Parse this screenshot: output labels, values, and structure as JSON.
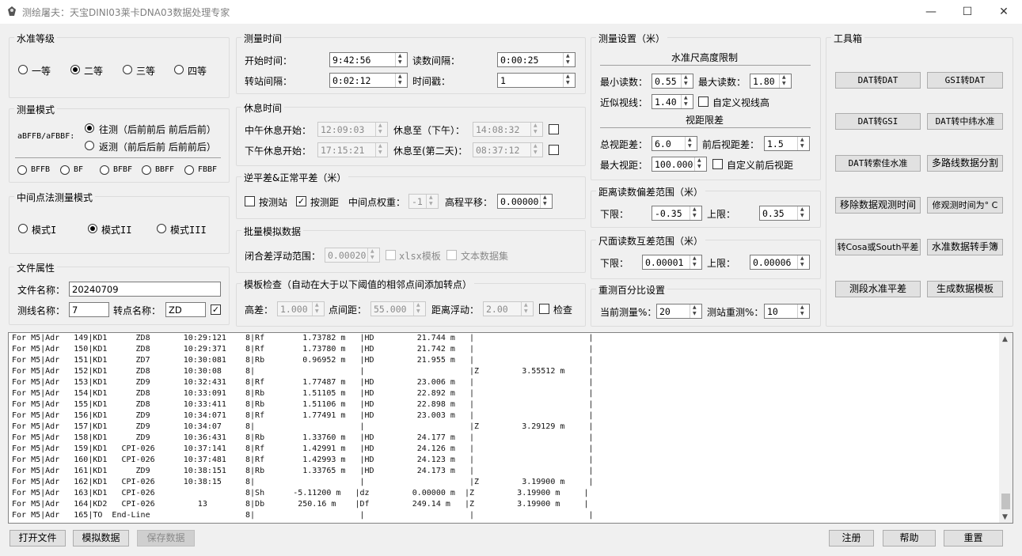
{
  "window": {
    "title": "测绘屠夫：天宝DINI03莱卡DNA03数据处理专家",
    "minimize": "—",
    "maximize": "☐",
    "close": "✕"
  },
  "level_grade": {
    "title": "水准等级",
    "options": [
      "一等",
      "二等",
      "三等",
      "四等"
    ],
    "selected": 1
  },
  "measure_mode": {
    "title": "测量模式",
    "prefix": "aBFFB/aFBBF:",
    "options": [
      "往测（后前前后 前后后前）",
      "返测（前后后前 后前前后）"
    ],
    "selected": 0,
    "patterns": [
      "BFFB",
      "BF",
      "BFBF",
      "BBFF",
      "FBBF"
    ]
  },
  "midpoint_mode": {
    "title": "中间点法测量模式",
    "options": [
      "模式I",
      "模式II",
      "模式III"
    ],
    "selected": 1
  },
  "file_props": {
    "title": "文件属性",
    "filename_label": "文件名称：",
    "filename": "20240709",
    "line_label": "测线名称：",
    "line_value": "7",
    "turn_label": "转点名称：",
    "turn_value": "ZD",
    "turn_checked": true
  },
  "measure_time": {
    "title": "测量时间",
    "start_label": "开始时间：",
    "start": "9:42:56",
    "interval_label": "读数间隔：",
    "interval": "0:00:25",
    "station_label": "转站间隔：",
    "station": "0:02:12",
    "stamp_label": "时间戳：",
    "stamp": "1"
  },
  "rest_time": {
    "title": "休息时间",
    "noon_start_label": "中午休息开始：",
    "noon_start": "12:09:03",
    "noon_end_label": "休息至（下午）：",
    "noon_end": "14:08:32",
    "pm_start_label": "下午休息开始：",
    "pm_start": "17:15:21",
    "pm_end_label": "休息至(第二天)：",
    "pm_end": "08:37:12"
  },
  "adjust": {
    "title": "逆平差&正常平差（米）",
    "by_station": "按测站",
    "by_station_checked": false,
    "by_distance": "按测距",
    "by_distance_checked": true,
    "weight_label": "中间点权重：",
    "weight": "-1",
    "shift_label": "高程平移：",
    "shift": "0.00000"
  },
  "batch": {
    "title": "批量模拟数据",
    "closure_label": "闭合差浮动范围：",
    "closure": "0.00020",
    "xlsx_label": "xlsx模板",
    "text_label": "文本数据集"
  },
  "template_check": {
    "title": "模板检查（自动在大于以下阈值的相邻点间添加转点）",
    "height_label": "高差：",
    "height": "1.000",
    "dist_label": "点间距：",
    "dist": "55.000",
    "float_label": "距离浮动：",
    "float": "2.00",
    "check_label": "检查"
  },
  "measure_settings": {
    "title": "测量设置（米）",
    "staff_title": "水准尺高度限制",
    "min_label": "最小读数：",
    "min": "0.55",
    "max_label": "最大读数：",
    "max": "1.80",
    "near_label": "近似视线：",
    "near": "1.40",
    "custom_sight_label": "自定义视线高",
    "sight_title": "视距限差",
    "total_label": "总视距差：",
    "total": "6.0",
    "fb_label": "前后视距差：",
    "fb": "1.5",
    "maxsight_label": "最大视距：",
    "maxsight": "100.000",
    "custom_fb_label": "自定义前后视距"
  },
  "dist_range": {
    "title": "距离读数偏差范围（米）",
    "low_label": "下限：",
    "low": "-0.35",
    "high_label": "上限：",
    "high": "0.35"
  },
  "staff_range": {
    "title": "尺面读数互差范围（米）",
    "low_label": "下限：",
    "low": "0.00001",
    "high_label": "上限：",
    "high": "0.00006"
  },
  "retest": {
    "title": "重测百分比设置",
    "current_label": "当前测量%：",
    "current": "20",
    "station_label": "测站重测%：",
    "station": "10"
  },
  "toolbox": {
    "title": "工具箱",
    "buttons": [
      "DAT转DAT",
      "GSI转DAT",
      "DAT转GSI",
      "DAT转中纬水准",
      "DAT转索佳水准",
      "多路线数据分割",
      "移除数据观测时间",
      "修观测时间为° C",
      "转Cosa或South平差",
      "水准数据转手簿",
      "测段水准平差",
      "生成数据模板"
    ]
  },
  "log_lines": [
    "For M5|Adr   149|KD1      ZD8       10:29:121    8|Rf        1.73782 m   |HD         21.744 m   |                        |",
    "For M5|Adr   150|KD1      ZD8       10:29:371    8|Rf        1.73780 m   |HD         21.742 m   |                        |",
    "For M5|Adr   151|KD1      ZD7       10:30:081    8|Rb        0.96952 m   |HD         21.955 m   |                        |",
    "For M5|Adr   152|KD1      ZD8       10:30:08     8|                      |                      |Z         3.55512 m     |",
    "For M5|Adr   153|KD1      ZD9       10:32:431    8|Rf        1.77487 m   |HD         23.006 m   |                        |",
    "For M5|Adr   154|KD1      ZD8       10:33:091    8|Rb        1.51105 m   |HD         22.892 m   |                        |",
    "For M5|Adr   155|KD1      ZD8       10:33:411    8|Rb        1.51106 m   |HD         22.898 m   |                        |",
    "For M5|Adr   156|KD1      ZD9       10:34:071    8|Rf        1.77491 m   |HD         23.003 m   |                        |",
    "For M5|Adr   157|KD1      ZD9       10:34:07     8|                      |                      |Z         3.29129 m     |",
    "For M5|Adr   158|KD1      ZD9       10:36:431    8|Rb        1.33760 m   |HD         24.177 m   |                        |",
    "For M5|Adr   159|KD1   CPI-026      10:37:141    8|Rf        1.42991 m   |HD         24.126 m   |                        |",
    "For M5|Adr   160|KD1   CPI-026      10:37:481    8|Rf        1.42993 m   |HD         24.123 m   |                        |",
    "For M5|Adr   161|KD1      ZD9       10:38:151    8|Rb        1.33765 m   |HD         24.173 m   |                        |",
    "For M5|Adr   162|KD1   CPI-026      10:38:15     8|                      |                      |Z         3.19900 m     |",
    "For M5|Adr   163|KD1   CPI-026                   8|Sh      -5.11200 m   |dz         0.00000 m  |Z         3.19900 m     |",
    "For M5|Adr   164|KD2   CPI-026         13        8|Db       250.16 m    |Df         249.14 m   |Z         3.19900 m     |",
    "For M5|Adr   165|TO  End-Line                    8|                      |                      |                        |"
  ],
  "bottom": {
    "open": "打开文件",
    "simulate": "模拟数据",
    "save": "保存数据",
    "register": "注册",
    "help": "帮助",
    "reset": "重置"
  }
}
